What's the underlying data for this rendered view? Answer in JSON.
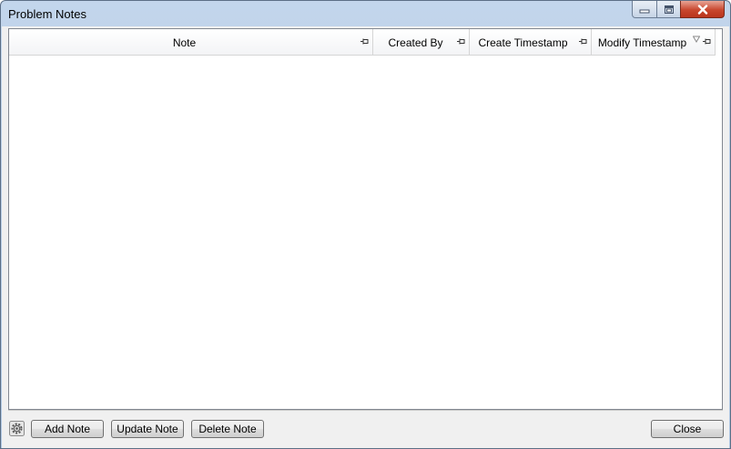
{
  "window": {
    "title": "Problem Notes",
    "controls": [
      "minimize-icon",
      "maximize-icon",
      "close-icon"
    ]
  },
  "grid": {
    "columns": [
      {
        "label": "Note",
        "pin_icon": "pin-icon"
      },
      {
        "label": "Created By",
        "pin_icon": "pin-icon"
      },
      {
        "label": "Create Timestamp",
        "pin_icon": "pin-icon"
      },
      {
        "label": "Modify Timestamp",
        "pin_icon": "pin-icon",
        "sort_icon": "sort-descending-icon"
      }
    ],
    "rows": []
  },
  "footer": {
    "settings_icon": "settings-icon",
    "add_label": "Add Note",
    "update_label": "Update Note",
    "delete_label": "Delete Note",
    "close_label": "Close"
  },
  "colors": {
    "frame": "#b9cde5",
    "close_button": "#c8472e",
    "grid_background": "#ffffff"
  }
}
